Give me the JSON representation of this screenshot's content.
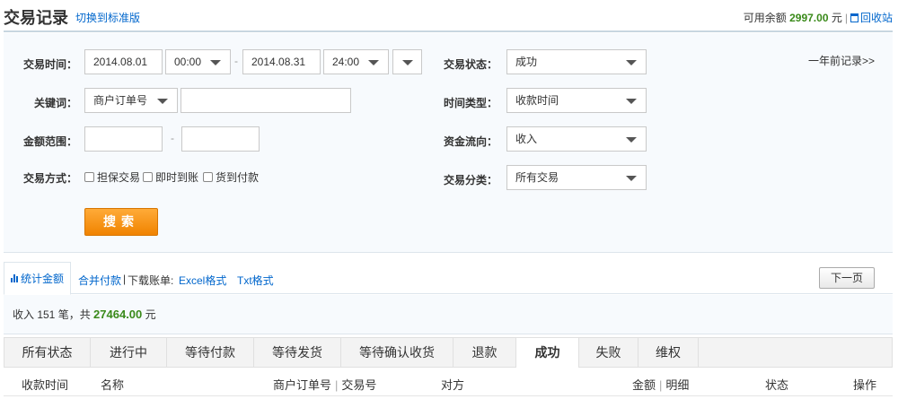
{
  "header": {
    "title": "交易记录",
    "switch_link": "切换到标准版",
    "balance_label": "可用余额",
    "balance_value": "2997.00",
    "balance_unit": "元",
    "recycle_label": "回收站"
  },
  "filters": {
    "time_label": "交易时间：",
    "date_from": "2014.08.01",
    "time_from": "00:00",
    "dash": "-",
    "date_to": "2014.08.31",
    "time_to": "24:00",
    "keyword_label": "关键词：",
    "keyword_type": "商户订单号",
    "keyword_value": "",
    "amount_label": "金额范围：",
    "amount_dash": "-",
    "method_label": "交易方式：",
    "methods": [
      "担保交易",
      "即时到账",
      "货到付款"
    ],
    "status_label": "交易状态：",
    "status_value": "成功",
    "timetype_label": "时间类型：",
    "timetype_value": "收款时间",
    "flow_label": "资金流向：",
    "flow_value": "收入",
    "category_label": "交易分类：",
    "category_value": "所有交易",
    "older_link": "一年前记录>>",
    "search_button": "搜索"
  },
  "summary": {
    "tab_label": "统计金额",
    "merge_pay": "合并付款",
    "download_label": "下载账单:",
    "excel": "Excel格式",
    "txt": "Txt格式",
    "next_page": "下一页",
    "income_prefix": "收入 151 笔，共",
    "income_amount": "27464.00",
    "income_unit": "元"
  },
  "status_tabs": [
    {
      "label": "所有状态",
      "active": false
    },
    {
      "label": "进行中",
      "active": false
    },
    {
      "label": "等待付款",
      "active": false
    },
    {
      "label": "等待发货",
      "active": false
    },
    {
      "label": "等待确认收货",
      "active": false
    },
    {
      "label": "退款",
      "active": false
    },
    {
      "label": "成功",
      "active": true
    },
    {
      "label": "失败",
      "active": false
    },
    {
      "label": "维权",
      "active": false
    }
  ],
  "table_headers": {
    "time": "收款时间",
    "name": "名称",
    "order_no": "商户订单号",
    "trade_no": "交易号",
    "counterparty": "对方",
    "amount": "金额",
    "detail": "明细",
    "status": "状态",
    "action": "操作"
  }
}
